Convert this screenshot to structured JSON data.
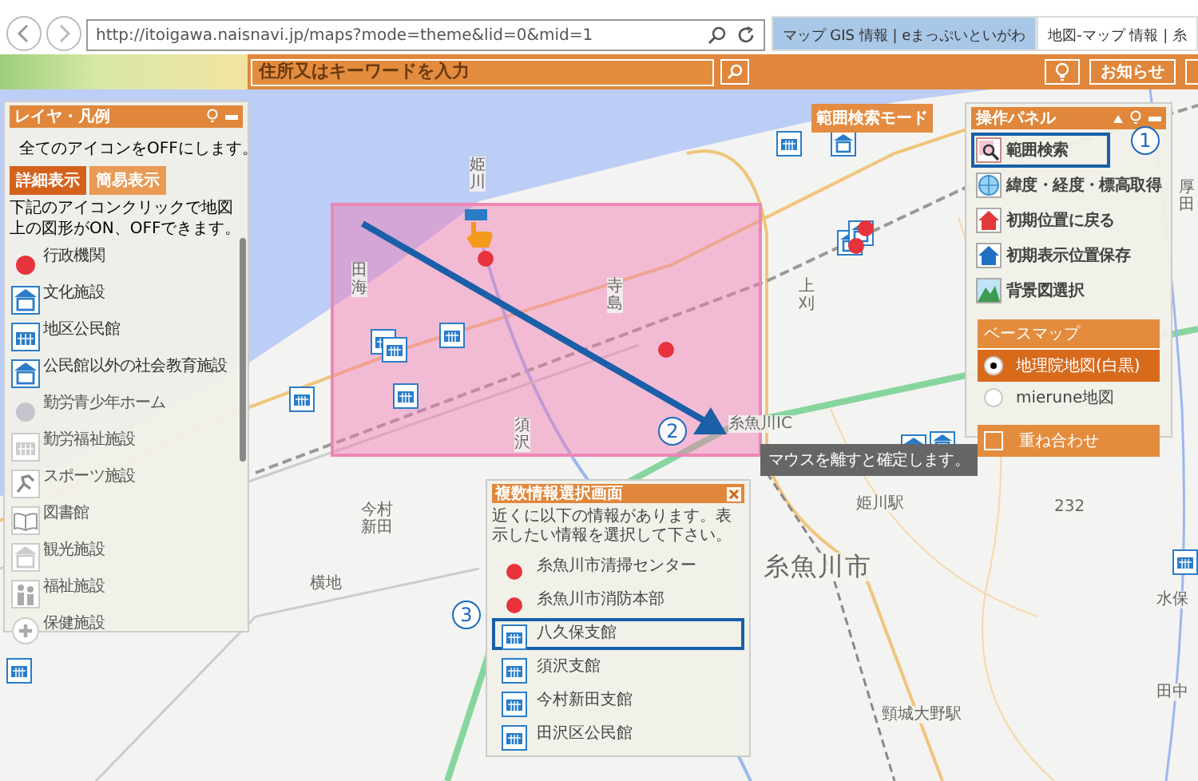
{
  "browser": {
    "url": "http://itoigawa.naisnavi.jp/maps?mode=theme&lid=0&mid=1",
    "tabs": [
      {
        "label": "マップ GIS 情報 | eまっぷいといがわ",
        "selected": true
      },
      {
        "label": "地図-マップ 情報 | 糸",
        "selected": false
      }
    ]
  },
  "header": {
    "search": {
      "placeholder": "住所又はキーワードを入力"
    },
    "notice_button": "お知らせ"
  },
  "layer_panel": {
    "title": "レイヤ・凡例",
    "all_off": "全てのアイコンをOFFにします。",
    "view_buttons": [
      {
        "label": "詳細表示",
        "selected": true
      },
      {
        "label": "簡易表示",
        "selected": false
      }
    ],
    "instruction": "下記のアイコンクリックで地図上の図形がON、OFFできます。",
    "layers": [
      {
        "name": "行政機関",
        "kind": "dot",
        "on": true
      },
      {
        "name": "文化施設",
        "kind": "culture",
        "on": true
      },
      {
        "name": "地区公民館",
        "kind": "hall",
        "on": true
      },
      {
        "name": "公民館以外の社会教育施設",
        "kind": "culture",
        "on": true
      },
      {
        "name": "勤労青少年ホーム",
        "kind": "dot",
        "on": false
      },
      {
        "name": "勤労福祉施設",
        "kind": "hall",
        "on": false
      },
      {
        "name": "スポーツ施設",
        "kind": "sports",
        "on": false
      },
      {
        "name": "図書館",
        "kind": "library",
        "on": false
      },
      {
        "name": "観光施設",
        "kind": "culture",
        "on": false
      },
      {
        "name": "福祉施設",
        "kind": "welfare",
        "on": false
      },
      {
        "name": "保健施設",
        "kind": "health",
        "on": false
      }
    ]
  },
  "control_panel": {
    "title": "操作パネル",
    "tools": [
      {
        "label": "範囲検索",
        "kind": "range",
        "selected": true
      },
      {
        "label": "緯度・経度・標高取得",
        "kind": "globe",
        "selected": false
      },
      {
        "label": "初期位置に戻る",
        "kind": "home_red",
        "selected": false
      },
      {
        "label": "初期表示位置保存",
        "kind": "home_blue",
        "selected": false
      },
      {
        "label": "背景図選択",
        "kind": "landscape",
        "selected": false
      }
    ],
    "basemap": {
      "title": "ベースマップ",
      "options": [
        {
          "label": "地理院地図(白黒)",
          "selected": true
        },
        {
          "label": "mierune地図",
          "selected": false
        }
      ]
    },
    "overlay": {
      "label": "重ね合わせ",
      "checked": false
    }
  },
  "mode_label": "範囲検索モード",
  "tooltip": "マウスを離すと確定します。",
  "popup": {
    "title": "複数情報選択画面",
    "message": "近くに以下の情報があります。表示したい情報を選択して下さい。",
    "items": [
      {
        "name": "糸魚川市清掃センター",
        "kind": "dot",
        "selected": false
      },
      {
        "name": "糸魚川市消防本部",
        "kind": "dot",
        "selected": false
      },
      {
        "name": "八久保支館",
        "kind": "hall",
        "selected": true
      },
      {
        "name": "須沢支館",
        "kind": "hall",
        "selected": false
      },
      {
        "name": "今村新田支館",
        "kind": "hall",
        "selected": false
      },
      {
        "name": "田沢区公民館",
        "kind": "hall",
        "selected": false
      }
    ]
  },
  "annotations": [
    "1",
    "2",
    "3"
  ],
  "map_labels": [
    "田海",
    "姫川",
    "寺島",
    "須沢",
    "今村新田",
    "横地",
    "糸魚川市",
    "姫川駅",
    "頸城大野駅",
    "上刈",
    "糸魚川IC",
    "水保",
    "田中",
    "232",
    "厚田"
  ]
}
